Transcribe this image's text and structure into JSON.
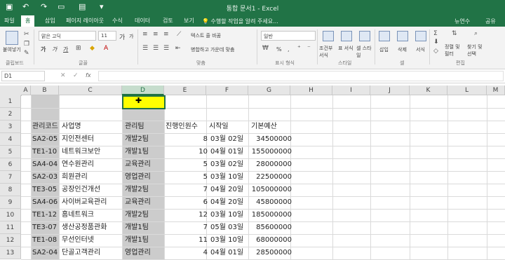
{
  "titlebar": {
    "title": "통합 문서1 - Excel",
    "qa_icons": [
      "save-icon",
      "undo-icon",
      "redo-icon",
      "new-file-icon",
      "open-file-icon",
      "customize-icon"
    ]
  },
  "menu": {
    "tabs": [
      "파일",
      "홈",
      "삽입",
      "페이지 레이아웃",
      "수식",
      "데이터",
      "검토",
      "보기"
    ],
    "tell_me": "수행할 작업을 알려 주세요...",
    "user": "뉴연수",
    "share": "공유"
  },
  "ribbon": {
    "paste_label": "붙여넣기",
    "font_name": "맑은 고딕",
    "font_size": "11",
    "font_size_up": "가",
    "font_size_down": "가",
    "bold": "가",
    "italic": "가",
    "underline": "가",
    "wrap_text": "텍스트 줄 바꿈",
    "merge_center": "병합하고 가운데 맞춤",
    "number_format": "일반",
    "percent": "%",
    "comma": ",",
    "cond_format": "조건부 서식",
    "table_format": "표 서식",
    "cell_style": "셀 스타일",
    "insert": "삽입",
    "delete": "삭제",
    "format": "서식",
    "sort_filter": "정렬 및 필터",
    "find_select": "찾기 및 선택",
    "group_clipboard": "클립보드",
    "group_font": "글꼴",
    "group_align": "맞춤",
    "group_number": "표시 형식",
    "group_styles": "스타일",
    "group_cells": "셀",
    "group_editing": "편집"
  },
  "formula_bar": {
    "name_box": "D1",
    "fx": "fx",
    "value": ""
  },
  "grid": {
    "columns": [
      "A",
      "B",
      "C",
      "D",
      "E",
      "F",
      "G",
      "H",
      "I",
      "J",
      "K",
      "L",
      "M"
    ],
    "selected_column": "D",
    "rows": [
      "1",
      "2",
      "3",
      "4",
      "5",
      "6",
      "7",
      "8",
      "9",
      "10",
      "11",
      "12",
      "13"
    ],
    "headers": {
      "code": "관리코드",
      "project": "사업명",
      "team": "관리팀",
      "staff": "진행인원수",
      "start": "시작일",
      "budget": "기본예산"
    },
    "records": [
      {
        "code": "SA2-05",
        "project": "지인전센터",
        "team": "개발2팀",
        "staff": "8",
        "start": "03월 02일",
        "budget": "34500000"
      },
      {
        "code": "TE1-10",
        "project": "네트워크보안",
        "team": "개발1팀",
        "staff": "10",
        "start": "04월 01일",
        "budget": "155000000"
      },
      {
        "code": "SA4-04",
        "project": "연수원관리",
        "team": "교육관리",
        "staff": "5",
        "start": "03월 02일",
        "budget": "28000000"
      },
      {
        "code": "SA2-03",
        "project": "희원관리",
        "team": "영업관리",
        "staff": "5",
        "start": "03월 10일",
        "budget": "22500000"
      },
      {
        "code": "TE3-05",
        "project": "공장인건개선",
        "team": "개발2팀",
        "staff": "7",
        "start": "04월 20일",
        "budget": "105000000"
      },
      {
        "code": "SA4-06",
        "project": "사이버교육관리",
        "team": "교육관리",
        "staff": "6",
        "start": "04월 20일",
        "budget": "45800000"
      },
      {
        "code": "TE1-12",
        "project": "홈네트워크",
        "team": "개발2팀",
        "staff": "12",
        "start": "03월 10일",
        "budget": "185000000"
      },
      {
        "code": "TE3-07",
        "project": "생산공정품관화",
        "team": "개발1팀",
        "staff": "7",
        "start": "05월 03일",
        "budget": "85600000"
      },
      {
        "code": "TE1-08",
        "project": "무선인터넷",
        "team": "개발1팀",
        "staff": "11",
        "start": "03월 10일",
        "budget": "68000000"
      },
      {
        "code": "SA2-04",
        "project": "단골고객관리",
        "team": "영업관리",
        "staff": "4",
        "start": "04월 01일",
        "budget": "28500000"
      }
    ]
  },
  "colors": {
    "brand": "#217346",
    "selected_column": "#cccccc"
  }
}
